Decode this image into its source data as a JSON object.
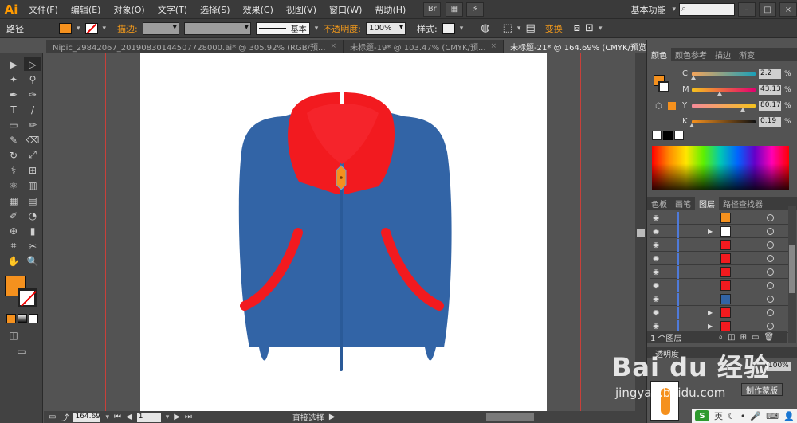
{
  "app": {
    "logo": "Ai"
  },
  "menu": [
    "文件(F)",
    "编辑(E)",
    "对象(O)",
    "文字(T)",
    "选择(S)",
    "效果(C)",
    "视图(V)",
    "窗口(W)",
    "帮助(H)"
  ],
  "menu_right": {
    "bridge": "Br",
    "workspace": "基本功能",
    "search_placeholder": ""
  },
  "control": {
    "object_type": "路径",
    "fill_color": "#f5911e",
    "stroke_label": "描边:",
    "stroke_style": "基本",
    "opacity_label": "不透明度:",
    "opacity_value": "100%",
    "style_label": "样式:",
    "transform_label": "变换"
  },
  "tabs": [
    {
      "label": "Nipic_29842067_20190830144507728000.ai* @ 305.92% (RGB/预...",
      "close": "×",
      "active": false
    },
    {
      "label": "未标题-19* @ 103.47% (CMYK/预...",
      "close": "×",
      "active": false
    },
    {
      "label": "未标题-21* @ 164.69% (CMYK/预览)",
      "close": "×",
      "active": true
    }
  ],
  "tools": [
    "▶",
    "▷",
    "✦",
    "⚲",
    "✒",
    "✑",
    "T",
    "/",
    "▭",
    "✏",
    "✎",
    "⌫",
    "↻",
    "⤢",
    "⚕",
    "⊞",
    "⚛",
    "▥",
    "▦",
    "▤",
    "✐",
    "◔",
    "⊕",
    "▮",
    "⌗",
    "✂",
    "✋",
    "🔍"
  ],
  "color_panel": {
    "tabs": [
      "颜色",
      "颜色参考",
      "描边",
      "渐变"
    ],
    "channels": [
      {
        "label": "C",
        "value": "2.2",
        "unit": "%",
        "level": 0.022
      },
      {
        "label": "M",
        "value": "43.13",
        "unit": "%",
        "level": 0.4313
      },
      {
        "label": "Y",
        "value": "80.17",
        "unit": "%",
        "level": 0.8017
      },
      {
        "label": "K",
        "value": "0.19",
        "unit": "%",
        "level": 0.0019
      }
    ]
  },
  "layers_panel": {
    "tabs": [
      "色板",
      "画笔",
      "图层",
      "路径查找器"
    ],
    "rows": 9,
    "footer": "1 个图层"
  },
  "transparency_panel": {
    "tab": "透明度",
    "opacity_value": "100%",
    "mask_button": "制作蒙版"
  },
  "status": {
    "zoom": "164.69",
    "page": "1",
    "tool": "直接选择"
  },
  "watermark": {
    "main": "Bai du 经验",
    "sub": "jingyan.baidu.com"
  },
  "tray": {
    "badge": "S",
    "ime": "英"
  },
  "colors": {
    "jacket_blue": "#3264a6",
    "collar_red": "#f21a1f",
    "collar_inner": "#f5242b",
    "pocket_red": "#f21a1f",
    "zip_pull": "#f5911e",
    "zip_line": "#2a5a98"
  }
}
